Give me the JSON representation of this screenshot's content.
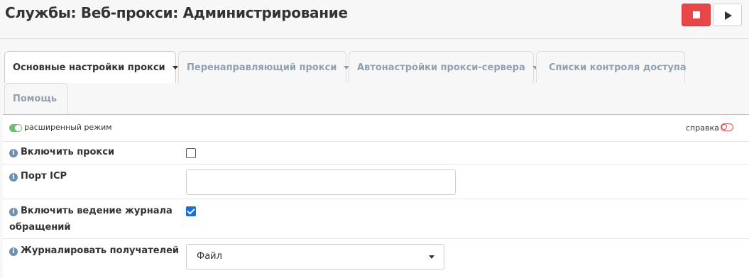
{
  "header": {
    "title": "Службы: Веб-прокси: Администрирование"
  },
  "tabs": [
    {
      "label": "Основные настройки прокси",
      "active": true,
      "dropdown": true
    },
    {
      "label": "Перенаправляющий прокси",
      "active": false,
      "dropdown": true
    },
    {
      "label": "Автонастройки прокси-сервера",
      "active": false,
      "dropdown": true
    },
    {
      "label": "Списки контроля доступа",
      "active": false,
      "dropdown": false
    },
    {
      "label": "Помощь",
      "active": false,
      "dropdown": false
    }
  ],
  "toolbar": {
    "advanced_mode_label": "расширенный режим",
    "help_label": "справка"
  },
  "form": {
    "enable_proxy": {
      "label": "Включить прокси",
      "checked": false
    },
    "icp_port": {
      "label": "Порт ICP",
      "value": ""
    },
    "access_log": {
      "label_line1": "Включить ведение журнала",
      "label_line2": "обращений",
      "checked": true
    },
    "log_target": {
      "label": "Журналировать получателей",
      "selected": "Файл"
    }
  },
  "colors": {
    "stop_button": "#e8474a",
    "checkbox_checked": "#1a6ed8",
    "toggle_on": "#6cc070",
    "info_icon": "#6f8fb1",
    "tab_inactive_text": "#8fa0b0"
  }
}
